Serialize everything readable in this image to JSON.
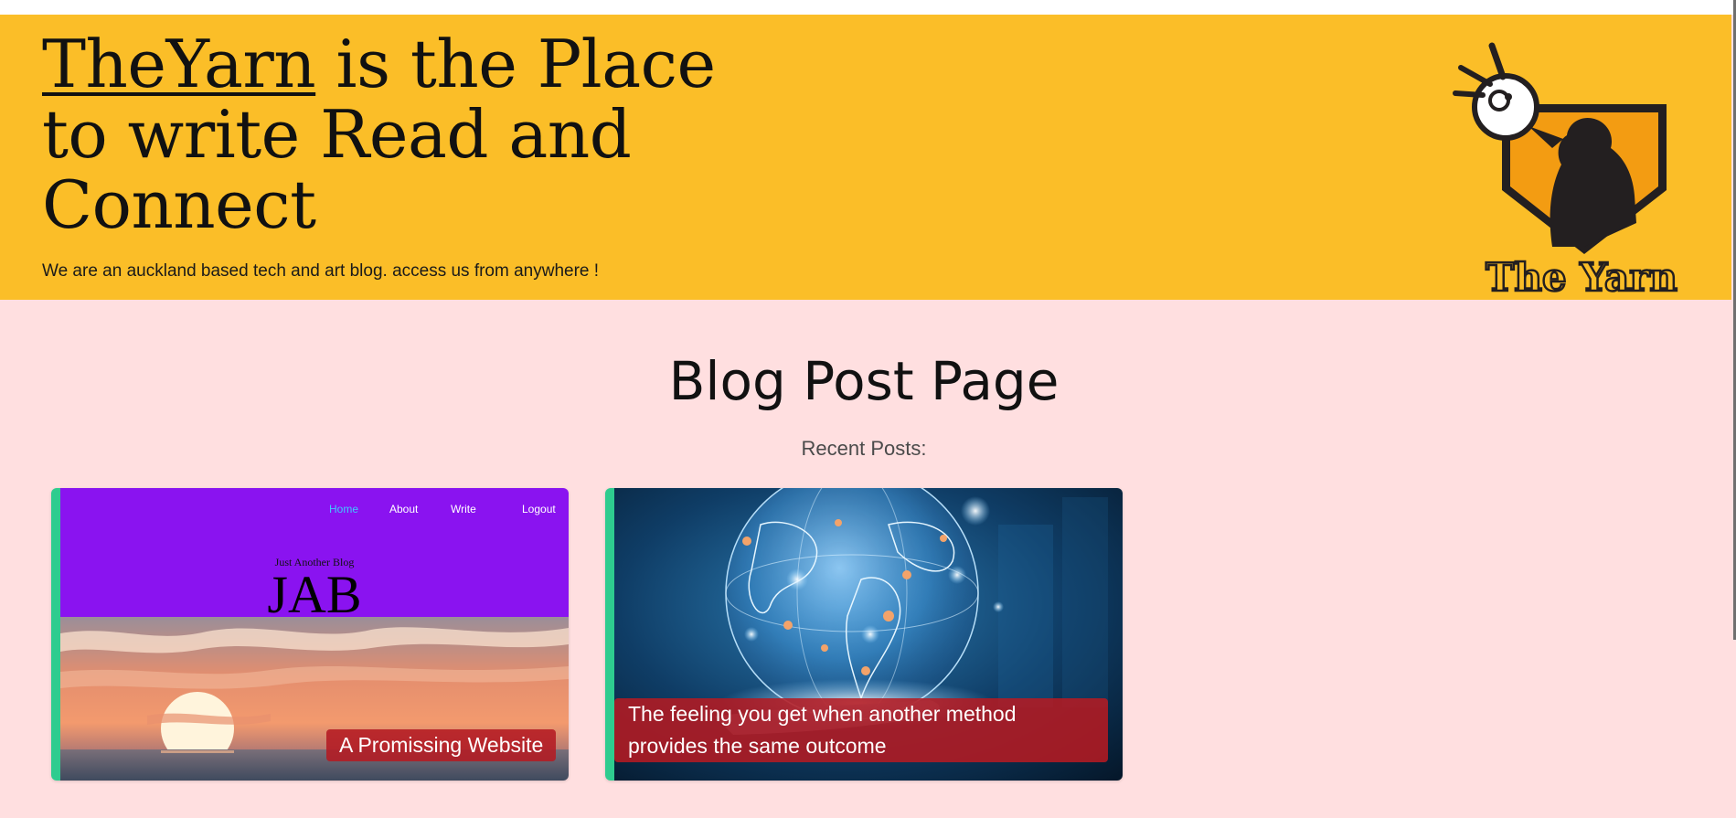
{
  "hero": {
    "title_link": "TheYarn",
    "title_rest": " is the Place to write Read and Connect",
    "subtitle": "We are an auckland based tech and art blog. access us from anywhere !",
    "logo_text": "The Yarn"
  },
  "page": {
    "title": "Blog Post Page",
    "recent_label": "Recent Posts:"
  },
  "posts": [
    {
      "caption": "A Promissing Website",
      "preview": {
        "nav": [
          "Home",
          "About",
          "Write",
          "Logout"
        ],
        "kicker": "Just Another Blog",
        "logo": "JAB"
      }
    },
    {
      "caption": "The feeling you get when another method provides the same outcome"
    }
  ],
  "colors": {
    "hero_bg": "#fbbe28",
    "page_bg": "#ffdfe0",
    "card_accent": "#2ecc8f",
    "caption_bg": "#b41a22",
    "preview_header": "#8a13f0",
    "preview_active_nav": "#40c8ff"
  }
}
